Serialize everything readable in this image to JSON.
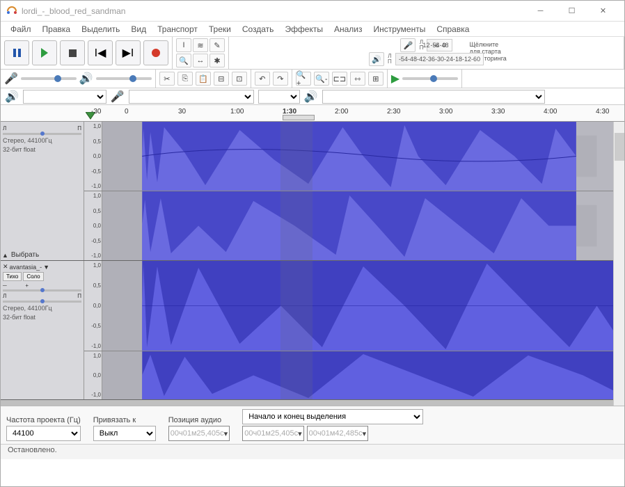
{
  "window": {
    "title": "lordi_-_blood_red_sandman"
  },
  "menu": [
    "Файл",
    "Правка",
    "Выделить",
    "Вид",
    "Транспорт",
    "Треки",
    "Создать",
    "Эффекты",
    "Анализ",
    "Инструменты",
    "Справка"
  ],
  "meters": {
    "rec_hint": "Щёлкните для старта мониторинга",
    "ticks": [
      "-54",
      "-48",
      "-42",
      "-36",
      "-30",
      "-24",
      "-18",
      "-12",
      "-6",
      "0"
    ]
  },
  "timeline": {
    "labels": [
      "-30",
      "0",
      "30",
      "1:00",
      "1:30",
      "2:00",
      "2:30",
      "3:00",
      "3:30",
      "4:00",
      "4:30"
    ]
  },
  "track1": {
    "name_btn": "Выбрать",
    "l": "Л",
    "r": "П",
    "info1": "Стерео, 44100Гц",
    "info2": "32-бит float",
    "axis": [
      "1,0",
      "0,5",
      "0,0",
      "-0,5",
      "-1,0"
    ]
  },
  "track2": {
    "name": "avantasia_-",
    "mute": "Тихо",
    "solo": "Соло",
    "l": "Л",
    "r": "П",
    "info1": "Стерео, 44100Гц",
    "info2": "32-бит float",
    "axis": [
      "1,0",
      "0,5",
      "0,0",
      "-0,5",
      "-1,0"
    ]
  },
  "bottom": {
    "rate_label": "Частота проекта (Гц)",
    "rate_value": "44100",
    "snap_label": "Привязать к",
    "snap_value": "Выкл",
    "pos_label": "Позиция аудио",
    "sel_label": "Начало и конец выделения",
    "tc_pos": "00ч01м25,405с",
    "tc_start": "00ч01м25,405с",
    "tc_end": "00ч01м42,485с"
  },
  "status": "Остановлено."
}
